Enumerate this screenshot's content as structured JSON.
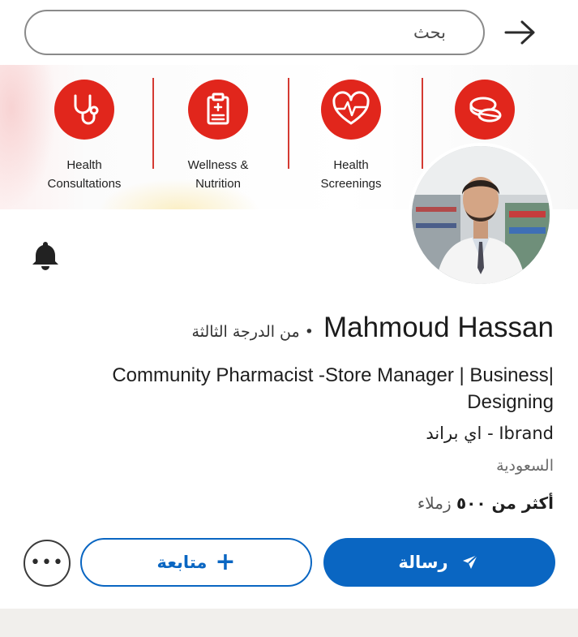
{
  "search": {
    "placeholder": "بحث"
  },
  "banner": {
    "services": [
      {
        "label_line1": "Health",
        "label_line2": "Consultations",
        "icon": "stethoscope-icon"
      },
      {
        "label_line1": "Wellness &",
        "label_line2": "Nutrition",
        "icon": "clipboard-icon"
      },
      {
        "label_line1": "Health",
        "label_line2": "Screenings",
        "icon": "heartbeat-icon"
      },
      {
        "label_line1": "",
        "label_line2": "",
        "icon": "pills-icon"
      }
    ],
    "accent_color": "#e1261c"
  },
  "profile": {
    "name": "Mahmoud Hassan",
    "degree": "• من الدرجة الثالثة",
    "headline": "Community Pharmacist -Store Manager | Business| Designing",
    "company": "Ibrand - اي براند",
    "location": "السعودية",
    "connections_bold": "أكثر من ٥٠٠",
    "connections_rest": " زملاء"
  },
  "actions": {
    "message_label": "رسالة",
    "follow_label": "متابعة",
    "more_label": "•••"
  },
  "colors": {
    "primary": "#0a66c2",
    "banner_red": "#e1261c"
  }
}
